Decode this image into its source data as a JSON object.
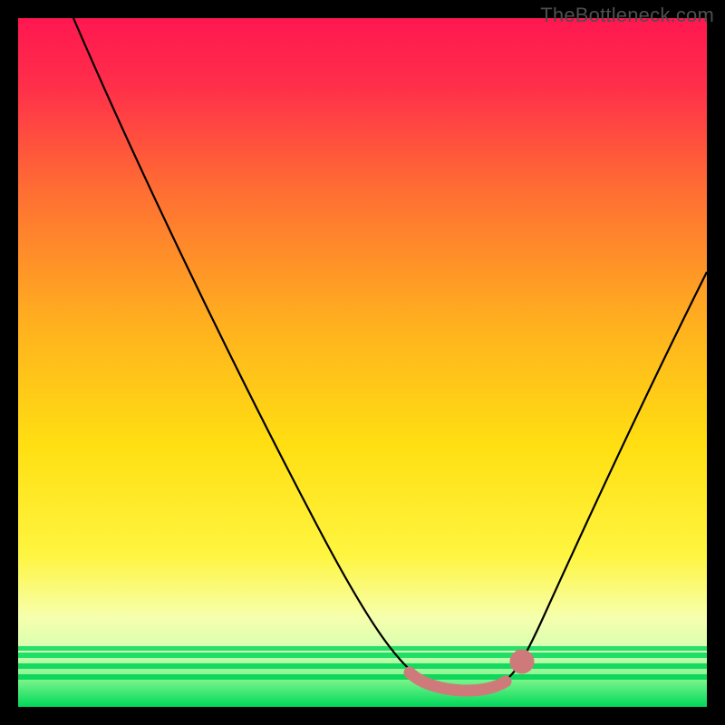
{
  "watermark": "TheBottleneck.com",
  "chart_data": {
    "type": "line",
    "title": "",
    "xlabel": "",
    "ylabel": "",
    "xlim": [
      0,
      100
    ],
    "ylim": [
      0,
      100
    ],
    "grid": false,
    "legend": false,
    "series": [
      {
        "name": "bottleneck-curve",
        "x": [
          8,
          15,
          22,
          30,
          37,
          45,
          52,
          57,
          60,
          63,
          66,
          69,
          72,
          78,
          84,
          90,
          96,
          100
        ],
        "y": [
          100,
          88,
          76,
          63,
          50,
          37,
          24,
          13,
          6,
          3,
          2,
          2.5,
          4,
          12,
          25,
          39,
          53,
          63
        ]
      }
    ],
    "highlight": {
      "name": "sweet-spot",
      "color": "#cf7a7a",
      "x": [
        57,
        60,
        63,
        66,
        69,
        72
      ],
      "y": [
        7,
        4,
        2.5,
        2.5,
        3.5,
        6
      ]
    },
    "background_gradient": {
      "top": "#ff1a4d",
      "mid1": "#ff9f1f",
      "mid2": "#ffe000",
      "band": "#f7ffb0",
      "bottom": "#00e05a"
    }
  }
}
